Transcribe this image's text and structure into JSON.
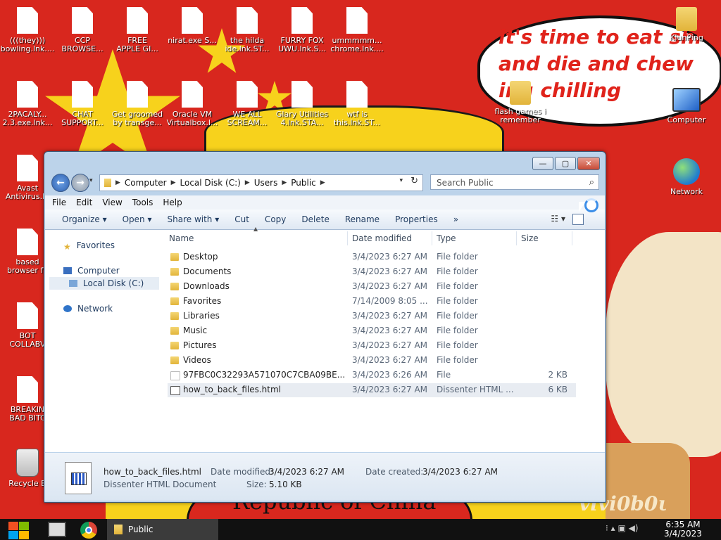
{
  "desktop": {
    "speech_text": "it's time to eat shi and die and chew ing chilling",
    "bottom_text": "Republic of China",
    "signature": "vivi0b0ι",
    "icons": [
      {
        "label": "(((they)))\nbowling.lnk....",
        "kind": "doc"
      },
      {
        "label": "CCP\nBROWSE...",
        "kind": "doc"
      },
      {
        "label": "FREE\nAPPLE GI...",
        "kind": "doc"
      },
      {
        "label": "nirat.exe S...",
        "kind": "doc"
      },
      {
        "label": "the hilda\nide.lnk.ST...",
        "kind": "doc"
      },
      {
        "label": "FURRY FOX\nUWU.lnk.S...",
        "kind": "doc"
      },
      {
        "label": "ummmmm...\nchrome.lnk....",
        "kind": "doc"
      },
      {
        "label": "2PACALY...\n2.3.exe.lnk...",
        "kind": "doc"
      },
      {
        "label": "CHAT\nSUPPORT...",
        "kind": "doc"
      },
      {
        "label": "Get groomed\nby transge...",
        "kind": "doc"
      },
      {
        "label": "Oracle VM\nVirtualbox.l...",
        "kind": "doc"
      },
      {
        "label": "WE ALL\nSCREAM...",
        "kind": "doc"
      },
      {
        "label": "Glary Utilities\n4.lnk.STA...",
        "kind": "doc"
      },
      {
        "label": "wtf is\nthis.lnk.ST...",
        "kind": "doc"
      },
      {
        "label": "Avast\nAntivirus.ln",
        "kind": "doc"
      },
      {
        "label": "based\nbrowser fo",
        "kind": "doc"
      },
      {
        "label": "BOT\nCOLLABV",
        "kind": "doc"
      },
      {
        "label": "BREAKIN\nBAD BITC",
        "kind": "doc"
      },
      {
        "label": "Recycle B",
        "kind": "bin"
      },
      {
        "label": "KiunPing",
        "kind": "folder"
      },
      {
        "label": "flash games i\nremember",
        "kind": "folder"
      },
      {
        "label": "Computer",
        "kind": "pc"
      },
      {
        "label": "Network",
        "kind": "net"
      }
    ]
  },
  "window": {
    "controls": {
      "minimize": "—",
      "maximize": "▢",
      "close": "✕"
    },
    "nav": {
      "back": "←",
      "forward": "→",
      "recent": "▾",
      "refresh": "↻",
      "dropdown": "▾"
    },
    "address": [
      "Computer",
      "Local Disk (C:)",
      "Users",
      "Public"
    ],
    "search_placeholder": "Search Public",
    "menu": [
      "File",
      "Edit",
      "View",
      "Tools",
      "Help"
    ],
    "toolbar": {
      "organize": "Organize ▾",
      "open": "Open ▾",
      "share": "Share with ▾",
      "cut": "Cut",
      "copy": "Copy",
      "delete": "Delete",
      "rename": "Rename",
      "properties": "Properties",
      "more": "»",
      "views": "☷ ▾"
    },
    "nav_pane": {
      "favorites": "Favorites",
      "computer": "Computer",
      "local_disk": "Local Disk (C:)",
      "network": "Network"
    },
    "columns": {
      "name": "Name",
      "date": "Date modified",
      "type": "Type",
      "size": "Size"
    },
    "sort_indicator": "▲",
    "files": [
      {
        "name": "Desktop",
        "date": "3/4/2023 6:27 AM",
        "type": "File folder",
        "size": ""
      },
      {
        "name": "Documents",
        "date": "3/4/2023 6:27 AM",
        "type": "File folder",
        "size": ""
      },
      {
        "name": "Downloads",
        "date": "3/4/2023 6:27 AM",
        "type": "File folder",
        "size": ""
      },
      {
        "name": "Favorites",
        "date": "7/14/2009 8:05 ...",
        "type": "File folder",
        "size": ""
      },
      {
        "name": "Libraries",
        "date": "3/4/2023 6:27 AM",
        "type": "File folder",
        "size": ""
      },
      {
        "name": "Music",
        "date": "3/4/2023 6:27 AM",
        "type": "File folder",
        "size": ""
      },
      {
        "name": "Pictures",
        "date": "3/4/2023 6:27 AM",
        "type": "File folder",
        "size": ""
      },
      {
        "name": "Videos",
        "date": "3/4/2023 6:27 AM",
        "type": "File folder",
        "size": ""
      },
      {
        "name": "97FBC0C32293A571070C7CBA09BE...",
        "date": "3/4/2023 6:26 AM",
        "type": "File",
        "size": "2 KB"
      },
      {
        "name": "how_to_back_files.html",
        "date": "3/4/2023 6:27 AM",
        "type": "Dissenter HTML ...",
        "size": "6 KB"
      }
    ],
    "details": {
      "filename": "how_to_back_files.html",
      "filetype": "Dissenter HTML Document",
      "date_modified_label": "Date modified:",
      "date_modified": "3/4/2023 6:27 AM",
      "date_created_label": "Date created:",
      "date_created": "3/4/2023 6:27 AM",
      "size_label": "Size:",
      "size": "5.10 KB"
    }
  },
  "taskbar": {
    "task_label": "Public",
    "tray_icons": "⁝  ▴  ▣  ◀)",
    "time": "6:35 AM",
    "date": "3/4/2023"
  },
  "colors": {
    "desktop_red": "#d8271e",
    "star_yellow": "#f7d21c",
    "accent_blue": "#2c5fae"
  }
}
